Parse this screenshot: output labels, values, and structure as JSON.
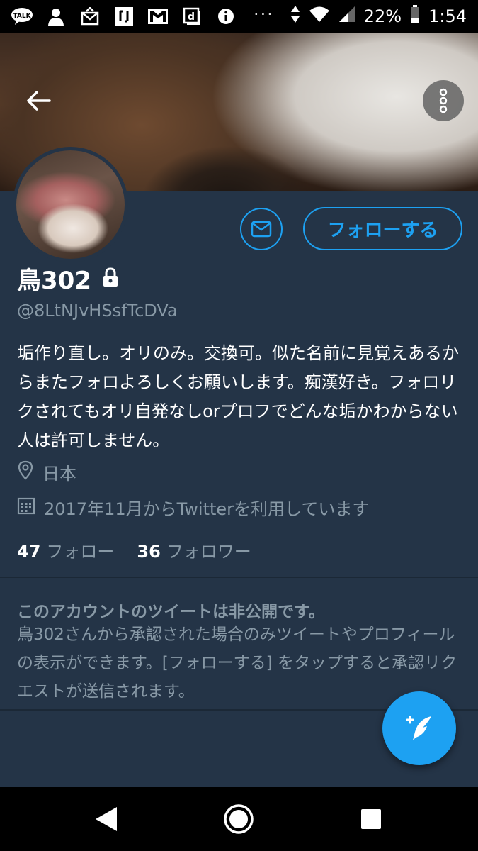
{
  "status_bar": {
    "battery_percent": "22%",
    "time": "1:54",
    "app_icons": [
      "talk-icon",
      "silhouette-icon",
      "mail-notice-icon",
      "bracket-icon",
      "gmail-icon",
      "d-icon",
      "info-icon"
    ],
    "more_dots": "···"
  },
  "header": {
    "back_icon": "arrow-left-icon",
    "more_icon": "more-vertical-icon"
  },
  "profile": {
    "name": "鳥302",
    "handle": "@8LtNJvHSsfTcDVa",
    "bio": "垢作り直し。オリのみ。交換可。似た名前に見覚えあるからまたフォロよろしくお願いします。痴漢好き。フォロリクされてもオリ自発なしorプロフでどんな垢かわからない人は許可しません。",
    "location": "日本",
    "joined": "2017年11月からTwitterを利用しています",
    "following_count": "47",
    "following_label": "フォロー",
    "followers_count": "36",
    "followers_label": "フォロワー"
  },
  "actions": {
    "follow_label": "フォローする"
  },
  "private_notice": {
    "title": "このアカウントのツイートは非公開です。",
    "body": "鳥302さんから承認された場合のみツイートやプロフィールの表示ができます。[フォローする] をタップすると承認リクエストが送信されます。"
  },
  "colors": {
    "accent": "#1da1f2",
    "background": "#243447",
    "secondary_text": "#8899a6"
  }
}
